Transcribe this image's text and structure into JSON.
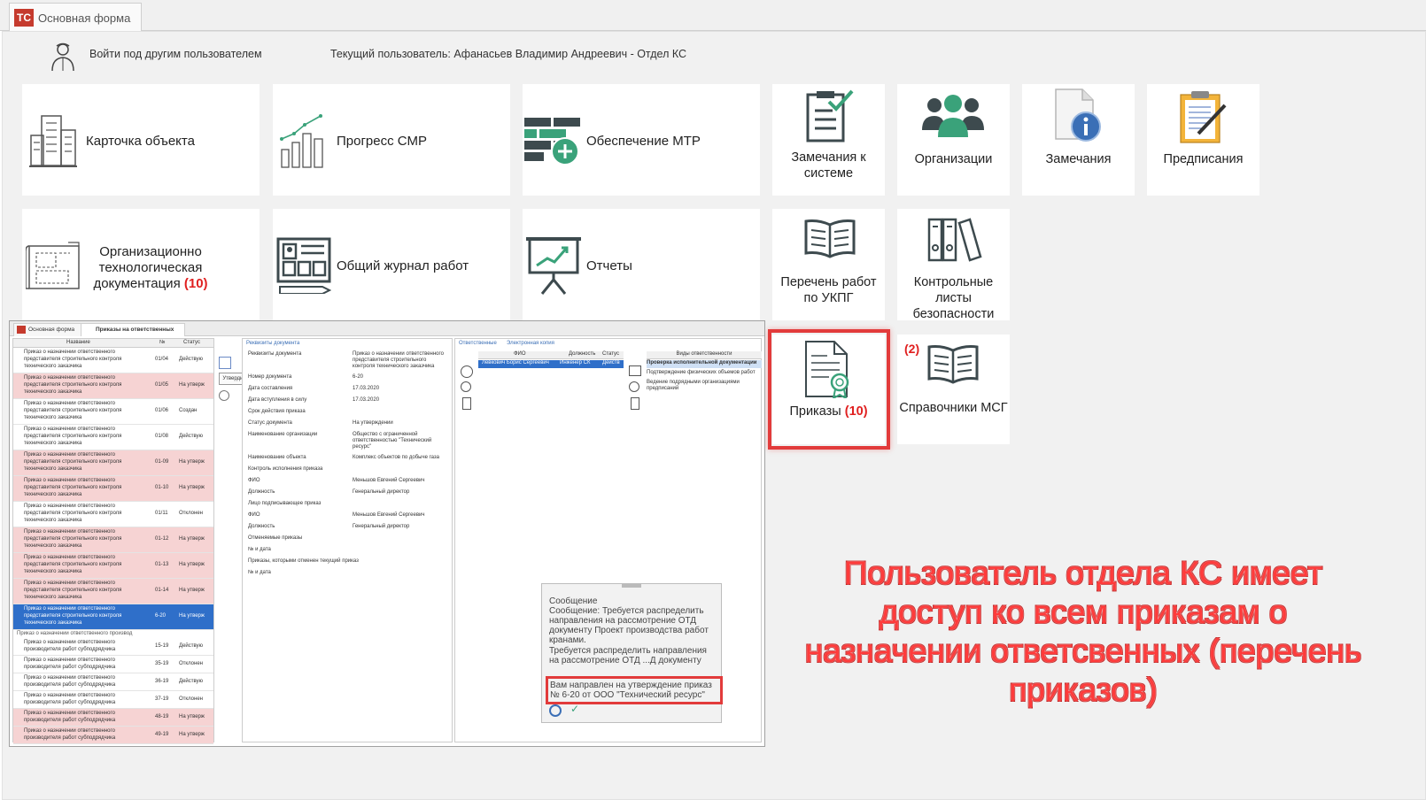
{
  "window": {
    "tab_label": "Основная форма",
    "logo_text": "ТС"
  },
  "userbar": {
    "switch_user_label": "Войти под другим пользователем",
    "current_user_text": "Текущий пользователь: Афанасьев Владимир Андреевич - Отдел КС"
  },
  "tiles": {
    "object_card": "Карточка объекта",
    "smr_progress": "Прогресс СМР",
    "mtr_supply": "Обеспечение МТР",
    "system_remarks": "Замечания к системе",
    "organizations": "Организации",
    "remarks": "Замечания",
    "prescriptions": "Предписания",
    "org_tech_doc": "Организационно технологическая документация",
    "org_tech_doc_badge": "(10)",
    "work_journal": "Общий журнал работ",
    "reports": "Отчеты",
    "ukpg_works": "Перечень работ по УКПГ",
    "safety_checklists": "Контрольные листы безопасности",
    "orders": "Приказы",
    "orders_badge": "(10)",
    "msg_directories": "Справочники МСГ",
    "msg_directories_badge": "(2)"
  },
  "embedded": {
    "tabs": [
      "Основная форма",
      "Приказы на ответственных"
    ],
    "list_headers": [
      "Название",
      "№",
      "Статус"
    ],
    "rows": [
      {
        "name": "Приказ о назначении ответственного представителя строительного контроля технического заказчика",
        "num": "01/04",
        "status": "Действую",
        "style": "white"
      },
      {
        "name": "Приказ о назначении ответственного представителя строительного контроля технического заказчика",
        "num": "01/05",
        "status": "На утверж",
        "style": "pink"
      },
      {
        "name": "Приказ о назначении ответственного представителя строительного контроля технического заказчика",
        "num": "01/06",
        "status": "Создан",
        "style": "white"
      },
      {
        "name": "Приказ о назначении ответственного представителя строительного контроля технического заказчика",
        "num": "01/08",
        "status": "Действую",
        "style": "white"
      },
      {
        "name": "Приказ о назначении ответственного представителя строительного контроля технического заказчика",
        "num": "01-09",
        "status": "На утверж",
        "style": "pink"
      },
      {
        "name": "Приказ о назначении ответственного представителя строительного контроля технического заказчика",
        "num": "01-10",
        "status": "На утверж",
        "style": "pink"
      },
      {
        "name": "Приказ о назначении ответственного представителя строительного контроля технического заказчика",
        "num": "01/11",
        "status": "Отклонен",
        "style": "white"
      },
      {
        "name": "Приказ о назначении ответственного представителя строительного контроля технического заказчика",
        "num": "01-12",
        "status": "На утверж",
        "style": "pink"
      },
      {
        "name": "Приказ о назначении ответственного представителя строительного контроля технического заказчика",
        "num": "01-13",
        "status": "На утверж",
        "style": "pink"
      },
      {
        "name": "Приказ о назначении ответственного представителя строительного контроля технического заказчика",
        "num": "01-14",
        "status": "На утверж",
        "style": "pink"
      },
      {
        "name": "Приказ о назначении ответственного представителя строительного контроля технического заказчика",
        "num": "6-20",
        "status": "На утверж",
        "style": "blue"
      }
    ],
    "group_label": "Приказ о назначении ответственного производ",
    "rows2": [
      {
        "name": "Приказ о назначении ответственного производителя работ субподрядчика",
        "num": "15-19",
        "status": "Действую",
        "style": "white"
      },
      {
        "name": "Приказ о назначении ответственного производителя работ субподрядчика",
        "num": "35-19",
        "status": "Отклонен",
        "style": "white"
      },
      {
        "name": "Приказ о назначении ответственного производителя работ субподрядчика",
        "num": "36-19",
        "status": "Действую",
        "style": "white"
      },
      {
        "name": "Приказ о назначении ответственного производителя работ субподрядчика",
        "num": "37-19",
        "status": "Отклонен",
        "style": "white"
      },
      {
        "name": "Приказ о назначении ответственного производителя работ субподрядчика",
        "num": "48-19",
        "status": "На утверж",
        "style": "pink"
      },
      {
        "name": "Приказ о назначении ответственного производителя работ субподрядчика",
        "num": "49-19",
        "status": "На утверж",
        "style": "pink"
      }
    ],
    "approve_tooltip": "Утвердить приказ",
    "doc_panel_title": "Реквизиты документа",
    "doc_fields": [
      {
        "label": "Реквизиты документа",
        "value": "Приказ о назначении ответственного представителя строительного контроля технического заказчика"
      },
      {
        "label": "Номер документа",
        "value": "6-20"
      },
      {
        "label": "Дата составления",
        "value": "17.03.2020"
      },
      {
        "label": "Дата вступления в силу",
        "value": "17.03.2020"
      },
      {
        "label": "Срок действия приказа",
        "value": ""
      },
      {
        "label": "Статус документа",
        "value": "На утверждении"
      },
      {
        "label": "Наименование организации",
        "value": "Общество с ограниченной ответственностью \"Технический ресурс\""
      },
      {
        "label": "Наименование объекта",
        "value": "Комплекс объектов по добыче газа"
      },
      {
        "label": "Контроль исполнения приказа",
        "value": ""
      },
      {
        "label": "ФИО",
        "value": "Меньшов Евгений Сергеевич"
      },
      {
        "label": "Должность",
        "value": "Генеральный директор"
      },
      {
        "label": "Лицо подписывающее приказ",
        "value": ""
      },
      {
        "label": "ФИО",
        "value": "Меньшов Евгений Сергеевич"
      },
      {
        "label": "Должность",
        "value": "Генеральный директор"
      },
      {
        "label": "Отменяемые приказы",
        "value": ""
      },
      {
        "label": "№ и дата",
        "value": ""
      },
      {
        "label": "Приказы, которыми отменен текущий приказ",
        "value": ""
      },
      {
        "label": "№ и дата",
        "value": ""
      }
    ],
    "right_tabs": [
      "Ответственные",
      "Электронная копия"
    ],
    "resp_headers": [
      "ФИО",
      "Должность",
      "Статус"
    ],
    "resp_row": {
      "fio": "Левкович Борис Сергеевич",
      "position": "Инженер СК",
      "status": "Действ"
    },
    "duties_header": "Виды ответственности",
    "duties": [
      "Проверка исполнительной документации",
      "Подтверждение физических объемов работ",
      "Ведение подрядными организациями предписаний"
    ],
    "message": {
      "title": "Сообщение",
      "text1": "Сообщение: Требуется распределить направления на рассмотрение ОТД документу Проект производства работ кранами.",
      "text2": "Требуется распределить направления на рассмотрение ОТД ...Д документу Проект производства работ",
      "highlight": "Вам направлен на утверждение приказ № 6-20 от ООО \"Технический ресурс\""
    }
  },
  "callout_text": "Пользователь отдела КС имеет доступ ко всем приказам о назначении ответсвенных (перечень приказов)",
  "colors": {
    "highlight_red": "#e23b3b",
    "callout_red": "#ff3b3b",
    "selected_blue": "#2f6fc9",
    "pink_row": "#f6d3d3"
  }
}
